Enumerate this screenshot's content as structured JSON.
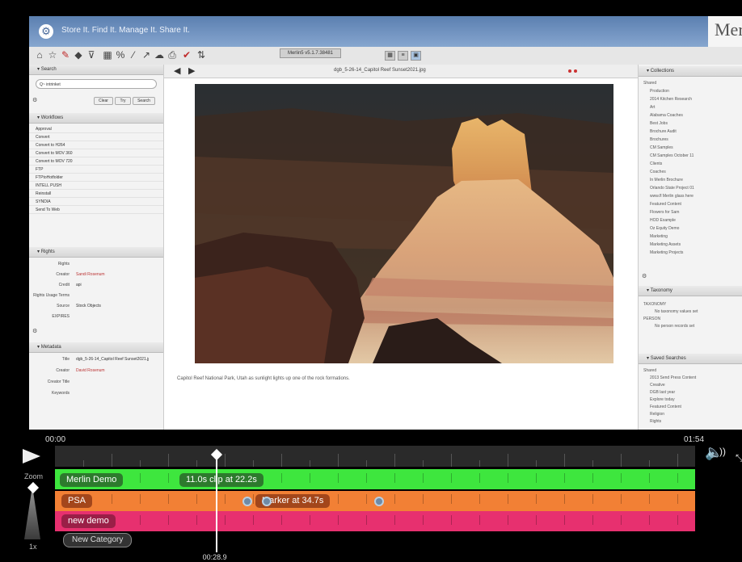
{
  "banner": {
    "tagline": "Store It. Find It. Manage It. Share It.",
    "brand": "Mer"
  },
  "toolbar": {
    "version": "Merlin5 v5.1.7.38481"
  },
  "left": {
    "search_header": "Search",
    "search_value": "Q~ intrinket",
    "buttons": [
      "Clear",
      "Try",
      "Search"
    ],
    "workflows_header": "Workflows",
    "workflows": [
      "Approval",
      "Convert",
      "Convert to H264",
      "Convert to MOV 360",
      "Convert to MOV 720",
      "FTP",
      "FTPtoHotfolder",
      "INTELL PUSH",
      "Reinstall",
      "SYNDIA",
      "Send To Web"
    ],
    "rights_header": "Rights",
    "rights": [
      {
        "label": "Rights",
        "value": ""
      },
      {
        "label": "Creator",
        "value": "Sandi Rosenum"
      },
      {
        "label": "Credit",
        "value": "api"
      },
      {
        "label": "Rights Usage Terms",
        "value": ""
      },
      {
        "label": "Source",
        "value": "Stock Objects"
      },
      {
        "label": "EXPIRES",
        "value": ""
      }
    ],
    "metadata_header": "Metadata",
    "metadata": [
      {
        "label": "Title",
        "value": "dgb_5-26-14_Capitol Reef Sunset2021.jpg"
      },
      {
        "label": "Creator",
        "value": "David Rosenum"
      },
      {
        "label": "Creator Title",
        "value": ""
      },
      {
        "label": "Keywords",
        "value": ""
      }
    ]
  },
  "center": {
    "filename": "dgb_5-26-14_Capitol Reef Sunset2021.jpg",
    "caption": "Capitol Reef National Park, Utah as sunlight lights up one of the rock formations."
  },
  "right": {
    "collections_header": "Collections",
    "collections": [
      "Shared",
      "Production",
      "2014 Kitchen Research",
      "Art",
      "Alabama Coaches",
      "Best Jobs",
      "Brochure Audit",
      "Brochures",
      "CM Samples",
      "CM Samples October 11",
      "Clients",
      "Coaches",
      "In Merlin Brochure",
      "Orlando State Project 01",
      "www.fl Merlin glass here",
      "Featured Content",
      "Flowers for Sam",
      "HOD Example",
      "Oz Equity Demo",
      "Marketing",
      "Marketing Assets",
      "Marketing Projects"
    ],
    "taxonomy_header": "Taxonomy",
    "taxonomy": [
      "TAXONOMY",
      "No taxonomy values set",
      "PERSON",
      "No person records set"
    ],
    "saved_header": "Saved Searches",
    "saved": [
      "Shared",
      "2013 Send Press Content",
      "Creative",
      "DGB last year",
      "Explore today",
      "Featured Content",
      "Religion",
      "Rights"
    ]
  },
  "timeline": {
    "start_time": "00:00",
    "end_time": "01:54",
    "playhead_time": "00:28.9",
    "playhead_fraction": 0.252,
    "zoom_label": "Zoom",
    "zoom_value": "1x",
    "categories": [
      {
        "name": "Merlin Demo",
        "color": "#3ee63e",
        "pill_color": "#2d7a2d"
      },
      {
        "name": "PSA",
        "color": "#f28035",
        "pill_color": "#a3461b"
      },
      {
        "name": "new demo",
        "color": "#e7306f",
        "pill_color": "#9a1f47"
      }
    ],
    "clip_label": "11.0s clip at 22.2s",
    "marker_label": "Marker at 34.7s",
    "new_category": "New Category"
  }
}
